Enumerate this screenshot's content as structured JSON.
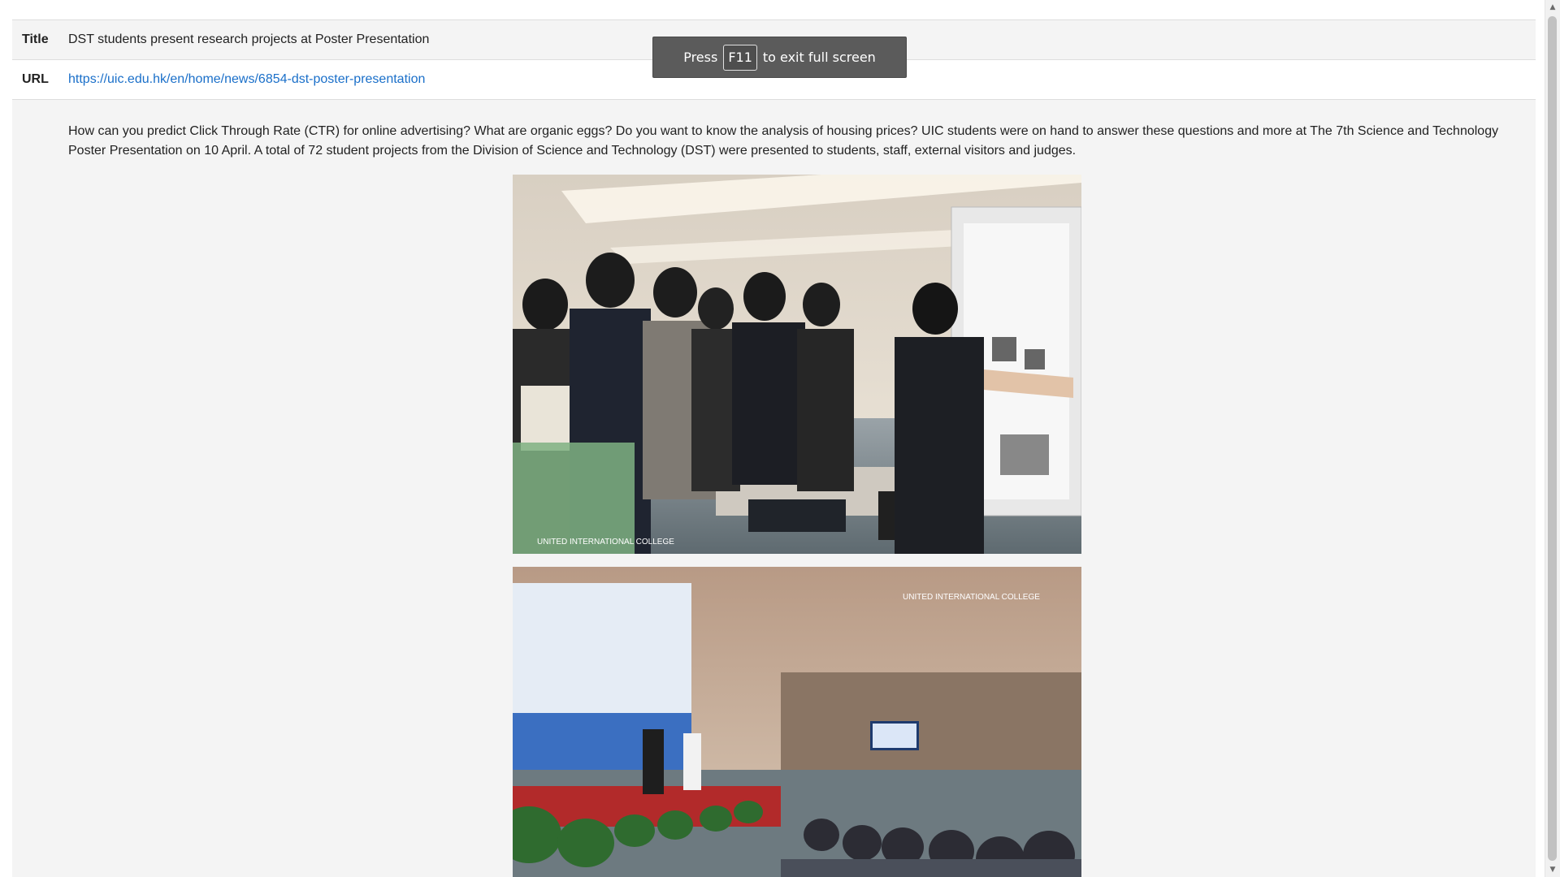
{
  "metadata": {
    "title_label": "Title",
    "title_value": "DST students present research projects at Poster Presentation",
    "url_label": "URL",
    "url_value": "https://uic.edu.hk/en/home/news/6854-dst-poster-presentation"
  },
  "article": {
    "paragraph": "How can you predict Click Through Rate (CTR) for online advertising? What are organic eggs? Do you want to know the analysis of housing prices? UIC students were on hand to answer these questions and more at The 7th Science and Technology Poster Presentation on 10 April. A total of 72 student projects from the Division of Science and Technology (DST) were presented to students, staff, external visitors and judges."
  },
  "fullscreen_toast": {
    "prefix": "Press",
    "key": "F11",
    "suffix": "to exit full screen"
  },
  "colors": {
    "link": "#1a6fc9",
    "row_background": "#f4f4f4",
    "toast_background": "#5b5b5b"
  },
  "icons": {
    "scroll_up": "triangle-up-icon",
    "scroll_down": "triangle-down-icon"
  }
}
